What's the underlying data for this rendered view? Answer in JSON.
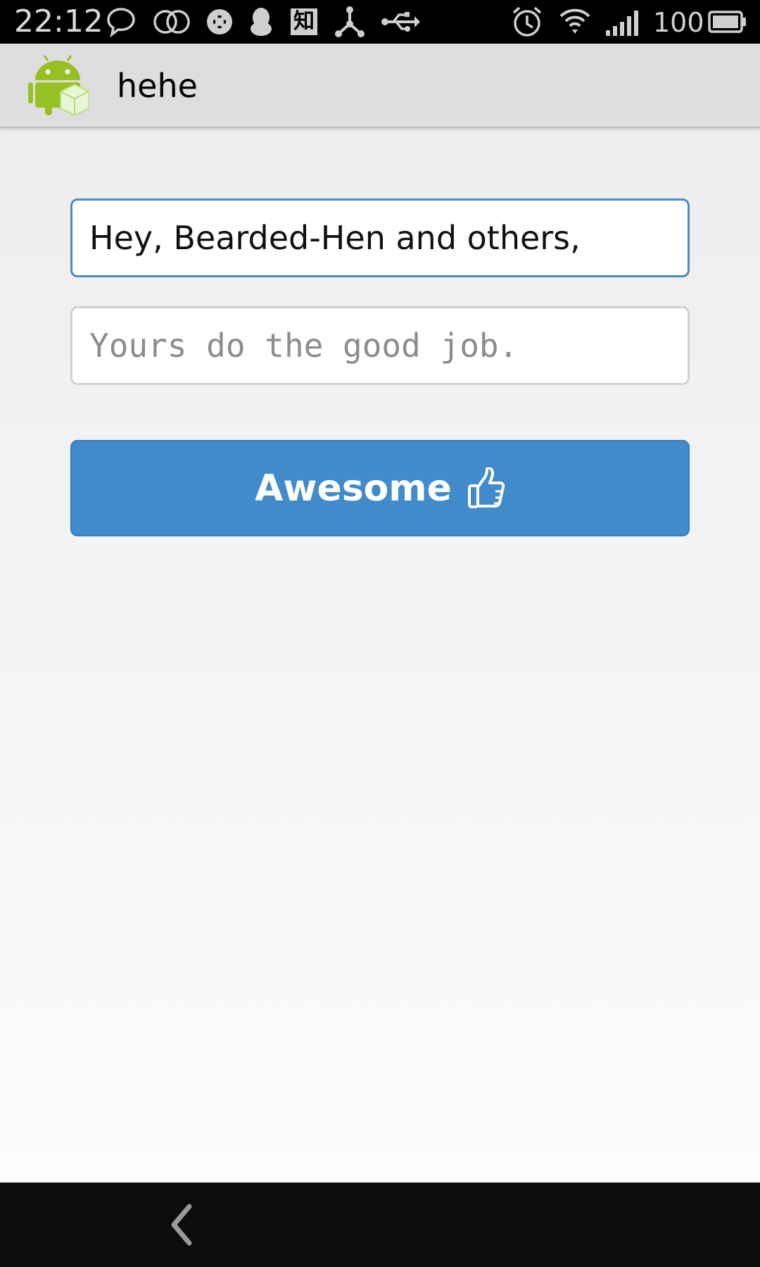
{
  "status_bar": {
    "time": "22:12",
    "battery_level": "100",
    "icons": [
      "chat-bubble-icon",
      "double-circle-icon",
      "sync-icon",
      "qq-penguin-icon",
      "zhihu-icon",
      "network-hub-icon",
      "usb-icon",
      "alarm-icon",
      "wifi-icon",
      "signal-icon",
      "battery-icon"
    ],
    "zhihu_glyph": "知"
  },
  "app_bar": {
    "title": "hehe",
    "icon": "android-app-icon"
  },
  "form": {
    "greeting_value": "Hey, Bearded-Hen and others,",
    "message_placeholder": "Yours do the good job.",
    "button_label": "Awesome",
    "button_icon": "thumbs-up-icon"
  },
  "colors": {
    "accent": "#428bca",
    "focus_border": "#4a8ac8",
    "android_green": "#97c024"
  },
  "nav_bar": {
    "back_icon": "back-chevron-icon"
  }
}
